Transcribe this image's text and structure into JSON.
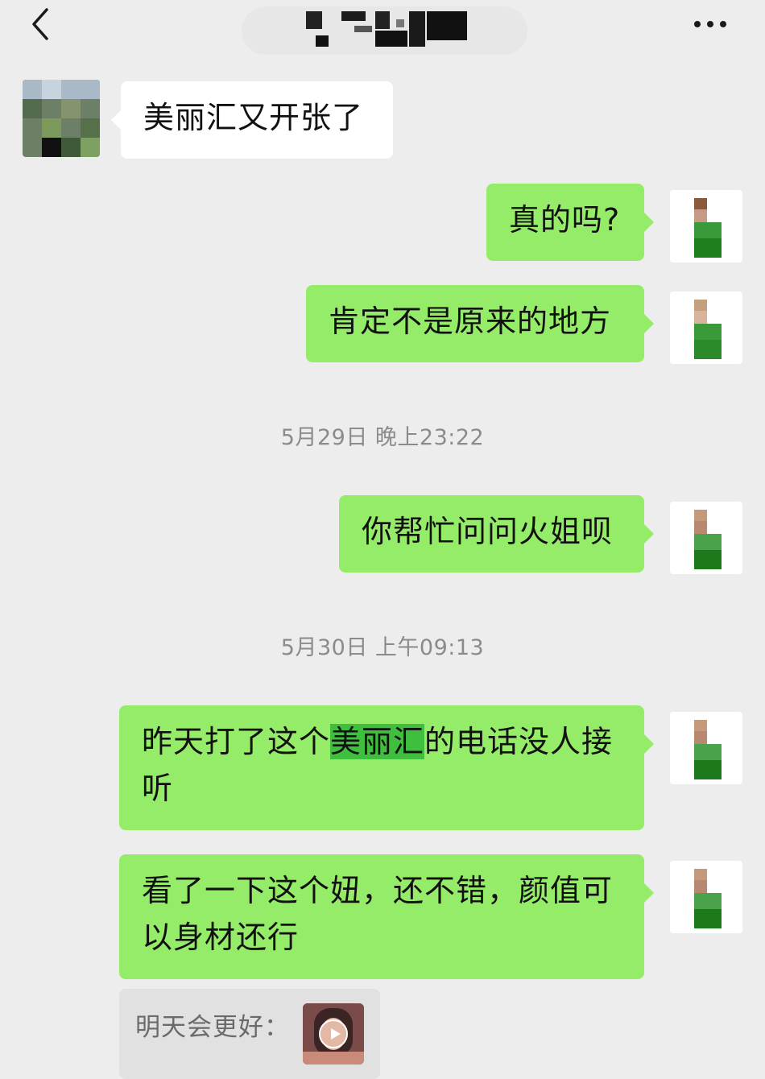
{
  "header": {
    "back_icon": "chevron-left-icon",
    "title": "",
    "more_icon": "more-dots-icon"
  },
  "messages": [
    {
      "side": "received",
      "text": "美丽汇又开张了"
    },
    {
      "side": "sent",
      "text": "真的吗?"
    },
    {
      "side": "sent",
      "text": "肯定不是原来的地方"
    },
    {
      "side": "timestamp",
      "text": "5月29日 晚上23:22"
    },
    {
      "side": "sent",
      "text": "你帮忙问问火姐呗"
    },
    {
      "side": "timestamp",
      "text": "5月30日 上午09:13"
    },
    {
      "side": "sent",
      "text_before": "昨天打了这个",
      "text_highlight": "美丽汇",
      "text_after": "的电话没人接听"
    },
    {
      "side": "sent",
      "text": "看了一下这个妞，还不错，颜值可以身材还行"
    }
  ],
  "quote": {
    "label": "明天会更好：",
    "thumb_icon": "play-icon"
  },
  "colors": {
    "background": "#ededed",
    "sent_bubble": "#95ec69",
    "received_bubble": "#ffffff",
    "highlight": "#3fbf3d",
    "timestamp": "#8b8b8b"
  }
}
